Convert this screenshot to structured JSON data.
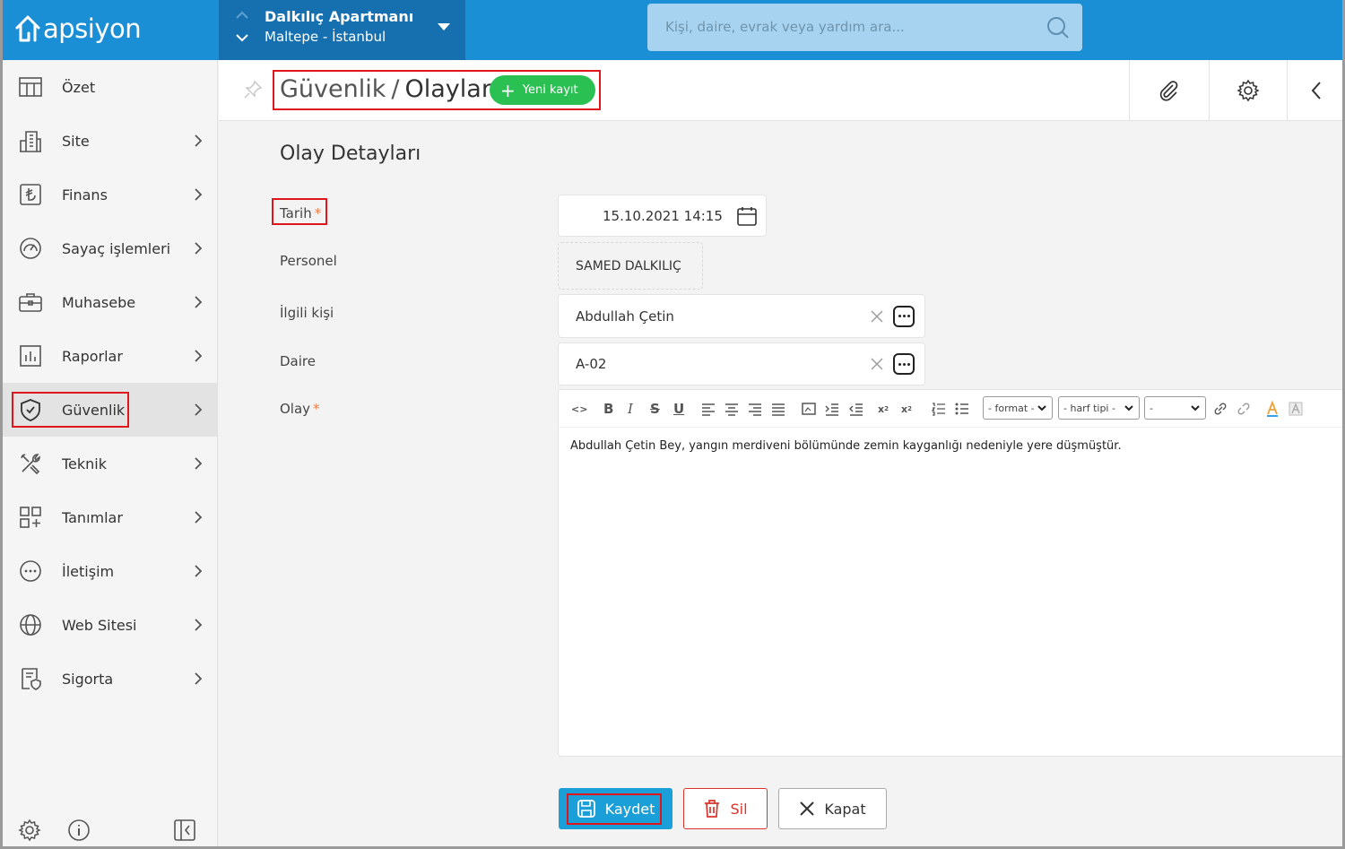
{
  "app": {
    "logo_text": "apsiyon"
  },
  "site": {
    "name": "Dalkılıç Apartmanı",
    "location": "Maltepe - İstanbul"
  },
  "search": {
    "placeholder": "Kişi, daire, evrak veya yardım ara..."
  },
  "sidebar": {
    "items": [
      {
        "label": "Özet",
        "icon": "table-icon",
        "has_chevron": false
      },
      {
        "label": "Site",
        "icon": "buildings-icon",
        "has_chevron": true
      },
      {
        "label": "Finans",
        "icon": "lira-icon",
        "has_chevron": true
      },
      {
        "label": "Sayaç işlemleri",
        "icon": "gauge-icon",
        "has_chevron": true
      },
      {
        "label": "Muhasebe",
        "icon": "briefcase-icon",
        "has_chevron": true
      },
      {
        "label": "Raporlar",
        "icon": "bar-chart-icon",
        "has_chevron": true
      },
      {
        "label": "Güvenlik",
        "icon": "shield-check-icon",
        "has_chevron": true,
        "active": true
      },
      {
        "label": "Teknik",
        "icon": "tools-icon",
        "has_chevron": true
      },
      {
        "label": "Tanımlar",
        "icon": "grid-plus-icon",
        "has_chevron": true
      },
      {
        "label": "İletişim",
        "icon": "chat-icon",
        "has_chevron": true
      },
      {
        "label": "Web Sitesi",
        "icon": "globe-icon",
        "has_chevron": true
      },
      {
        "label": "Sigorta",
        "icon": "insurance-icon",
        "has_chevron": true
      }
    ]
  },
  "header": {
    "section": "Güvenlik",
    "separator": "/",
    "page": "Olaylar",
    "new_button": "Yeni kayıt"
  },
  "form": {
    "title": "Olay Detayları",
    "fields": {
      "tarih": {
        "label": "Tarih",
        "required_mark": "*",
        "value": "15.10.2021 14:15"
      },
      "personel": {
        "label": "Personel",
        "value": "SAMED DALKILIÇ"
      },
      "ilgili_kisi": {
        "label": "İlgili kişi",
        "value": "Abdullah Çetin"
      },
      "daire": {
        "label": "Daire",
        "value": "A-02"
      },
      "olay": {
        "label": "Olay",
        "required_mark": "*"
      }
    },
    "editor": {
      "format_select": "- format -",
      "font_select": "- harf tipi -",
      "size_select": "-",
      "content": "Abdullah Çetin Bey, yangın merdiveni bölümünde zemin kayganlığı nedeniyle yere düşmüştür."
    }
  },
  "actions": {
    "save": "Kaydet",
    "delete": "Sil",
    "close": "Kapat"
  },
  "colors": {
    "topbar": "#1b8fd6",
    "site_switch": "#1670b0",
    "green": "#2bc152",
    "save": "#1a9fd9",
    "danger": "#d9342b",
    "highlight": "#e0161d"
  }
}
